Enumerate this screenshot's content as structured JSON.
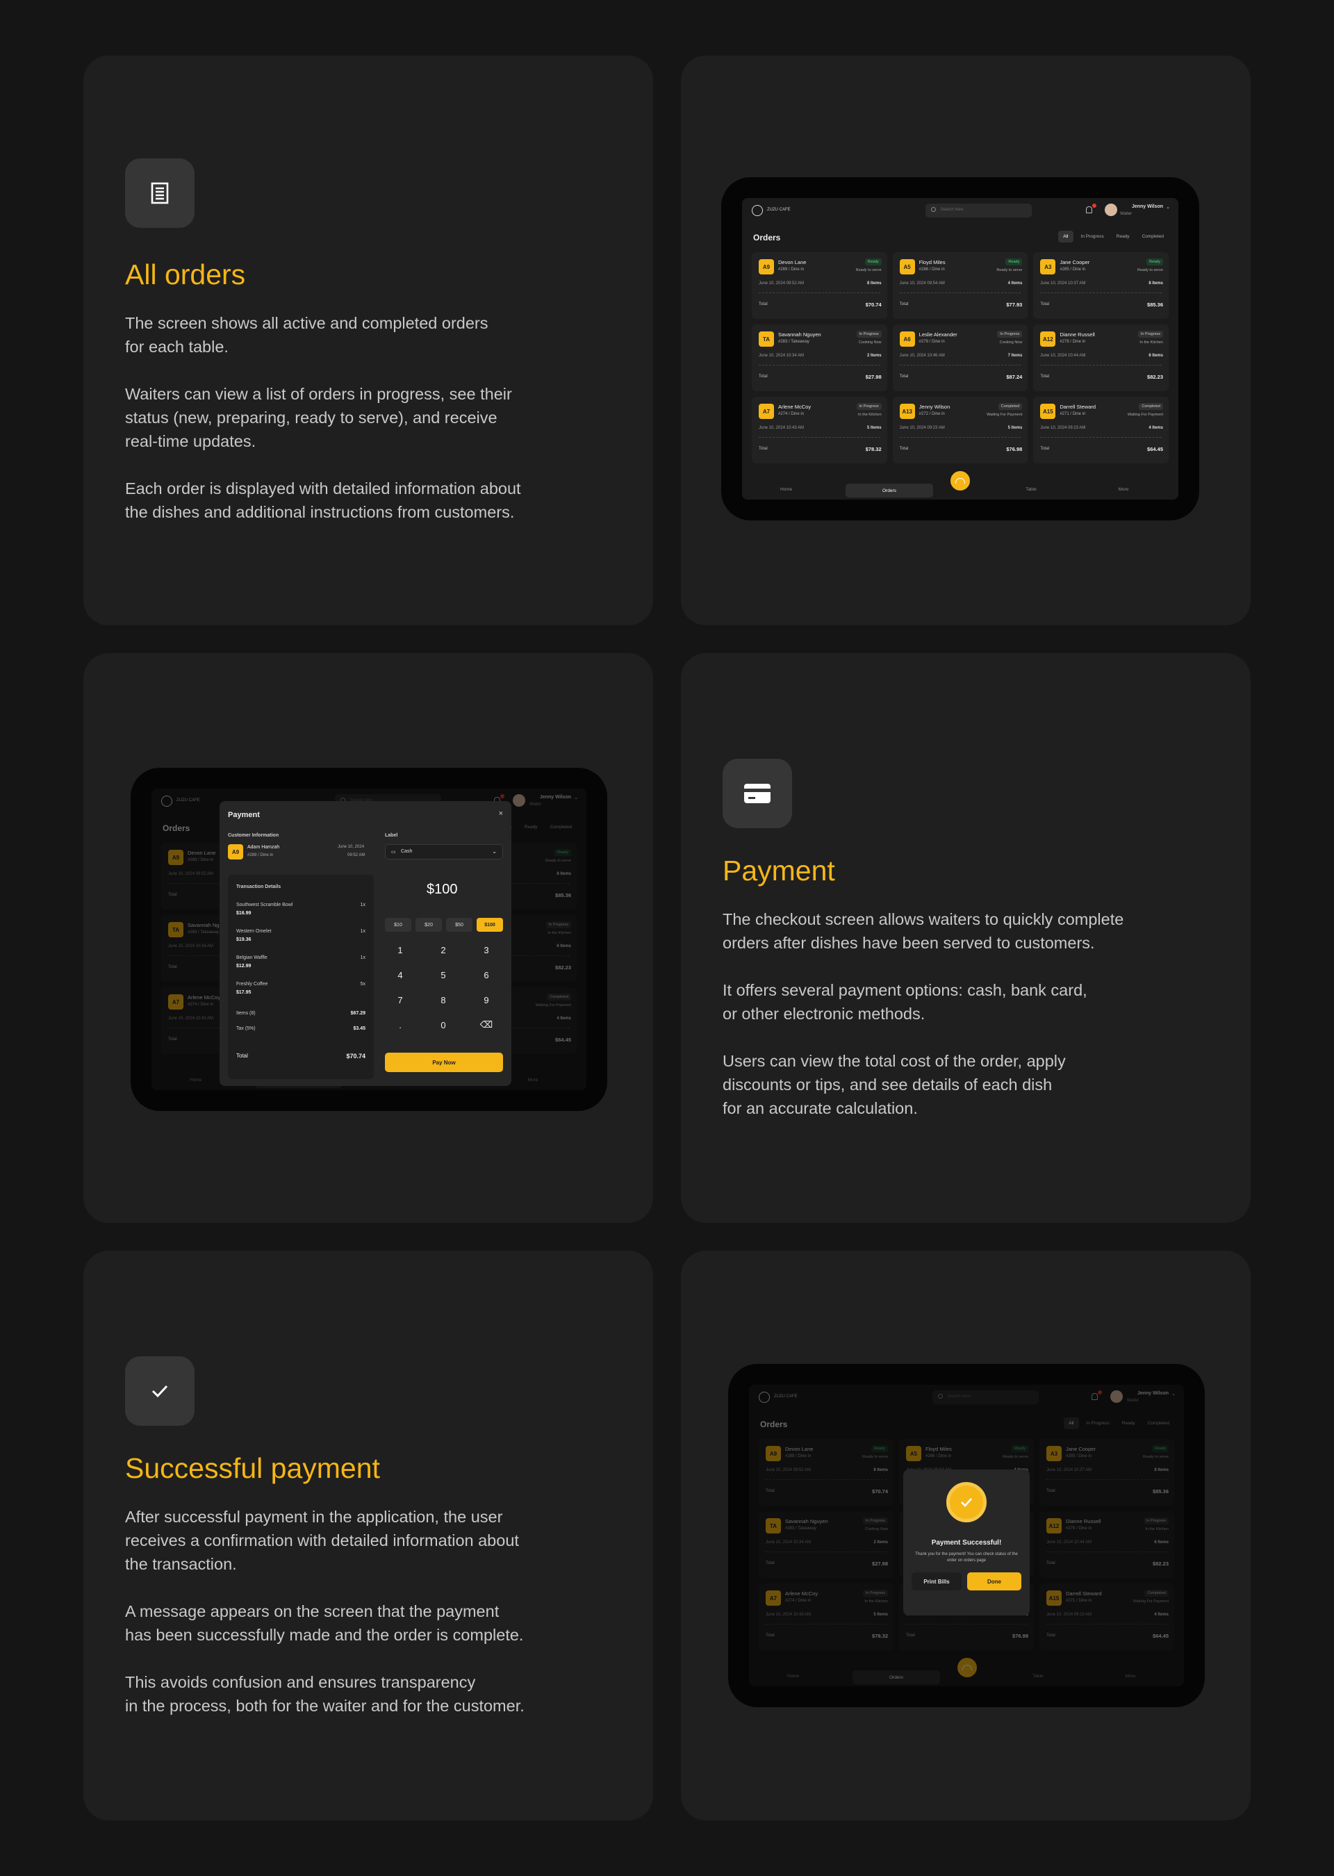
{
  "sections": {
    "all_orders": {
      "icon": "receipt-icon",
      "title": "All orders",
      "paragraphs": [
        "The screen shows all active and completed orders\nfor each table.",
        "Waiters can view a list of orders in progress, see their\nstatus (new, preparing, ready to serve), and receive\nreal-time updates.",
        "Each order is displayed with detailed information about\nthe dishes and additional instructions from customers."
      ]
    },
    "payment": {
      "icon": "credit-card-icon",
      "title": "Payment",
      "paragraphs": [
        "The checkout screen allows waiters to quickly complete\norders after dishes have been served to customers.",
        "It offers several payment options: cash, bank card,\nor other electronic methods.",
        "Users can view the total cost of the order, apply\ndiscounts or tips, and see details of each dish\nfor an accurate calculation."
      ]
    },
    "success": {
      "icon": "check-icon",
      "title": "Successful payment",
      "paragraphs": [
        "After successful payment in the application, the user\nreceives a confirmation with detailed information about\nthe transaction.",
        "A message appears on the screen that the payment\nhas been successfully made and the order is complete.",
        "This avoids confusion and ensures transparency\nin the process, both for the waiter and for the customer."
      ]
    }
  },
  "app": {
    "brand": "ZUZU CAFE",
    "search_placeholder": "Search here",
    "user_name": "Jenny Wilson",
    "user_role": "Waiter",
    "orders_title": "Orders",
    "filters": [
      "All",
      "In Progress",
      "Ready",
      "Completed"
    ],
    "total_label": "Total",
    "nav": {
      "home": "Home",
      "orders": "Orders",
      "table": "Table",
      "more": "More"
    },
    "orders": [
      {
        "tag": "A9",
        "name": "Devon Lane",
        "sub": "#289 / Dine in",
        "status": "Ready",
        "sdesc": "Ready to serve",
        "date": "June 10, 2024 09:52 AM",
        "items": "8 Items",
        "total": "$70.74",
        "ready": true
      },
      {
        "tag": "A5",
        "name": "Floyd Miles",
        "sub": "#286 / Dine in",
        "status": "Ready",
        "sdesc": "Ready to serve",
        "date": "June 10, 2024 09:54 AM",
        "items": "4 Items",
        "total": "$77.93",
        "ready": true
      },
      {
        "tag": "A3",
        "name": "Jane Cooper",
        "sub": "#285 / Dine in",
        "status": "Ready",
        "sdesc": "Ready to serve",
        "date": "June 10, 2024 10:37 AM",
        "items": "8 Items",
        "total": "$85.36",
        "ready": true
      },
      {
        "tag": "TA",
        "name": "Savannah Nguyen",
        "sub": "#283 / Takeaway",
        "status": "In Progress",
        "sdesc": "Cooking Now",
        "date": "June 10, 2024 10:34 AM",
        "items": "2 Items",
        "total": "$27.98",
        "ready": false
      },
      {
        "tag": "A6",
        "name": "Leslie Alexander",
        "sub": "#279 / Dine in",
        "status": "In Progress",
        "sdesc": "Cooking Now",
        "date": "June 10, 2024 10:46 AM",
        "items": "7 Items",
        "total": "$87.24",
        "ready": false
      },
      {
        "tag": "A12",
        "name": "Dianne Russell",
        "sub": "#278 / Dine in",
        "status": "In Progress",
        "sdesc": "In the Kitchen",
        "date": "June 10, 2024 10:44 AM",
        "items": "6 Items",
        "total": "$82.23",
        "ready": false
      },
      {
        "tag": "A7",
        "name": "Arlene McCoy",
        "sub": "#274 / Dine in",
        "status": "In Progress",
        "sdesc": "In the Kitchen",
        "date": "June 10, 2024 10:43 AM",
        "items": "5 Items",
        "total": "$78.32",
        "ready": false
      },
      {
        "tag": "A13",
        "name": "Jenny Wilson",
        "sub": "#272 / Dine in",
        "status": "Completed",
        "sdesc": "Waiting For Payment",
        "date": "June 10, 2024 09:23 AM",
        "items": "5 Items",
        "total": "$76.98",
        "ready": false
      },
      {
        "tag": "A15",
        "name": "Darrell Steward",
        "sub": "#271 / Dine in",
        "status": "Completed",
        "sdesc": "Waiting For Payment",
        "date": "June 10, 2024 09:23 AM",
        "items": "4 Items",
        "total": "$64.45",
        "ready": false
      }
    ]
  },
  "payment_modal": {
    "title": "Payment",
    "customer_info_label": "Customer Information",
    "customer_tag": "A9",
    "customer_name": "Adam Hamzah",
    "customer_sub": "#289 / Dine in",
    "date": "June 10, 2024",
    "time": "09:52 AM",
    "transaction_label": "Transaction Details",
    "items": [
      {
        "name": "Southwest Scramble Bowl",
        "qty": "1x",
        "price": "$16.99"
      },
      {
        "name": "Western Omelet",
        "qty": "1x",
        "price": "$19.36"
      },
      {
        "name": "Belgian Waffle",
        "qty": "1x",
        "price": "$12.99"
      },
      {
        "name": "Freshly Coffee",
        "qty": "5x",
        "price": "$17.95"
      }
    ],
    "items_label": "Items (8)",
    "items_total": "$67.29",
    "tax_label": "Tax (5%)",
    "tax": "$3.45",
    "total_label": "Total",
    "total": "$70.74",
    "method_label": "Label",
    "method": "Cash",
    "amount": "$100",
    "quick": [
      "$10",
      "$20",
      "$50",
      "$100"
    ],
    "keys": [
      "1",
      "2",
      "3",
      "4",
      "5",
      "6",
      "7",
      "8",
      "9",
      ".",
      "0",
      "⌫"
    ],
    "pay_button": "Pay Now"
  },
  "success_modal": {
    "title": "Payment Successful!",
    "message": "Thank you for the payment! You can check status of the order on orders page",
    "print": "Print Bills",
    "done": "Done"
  },
  "colors": {
    "accent": "#f5b617",
    "card": "#1f1f1f",
    "bg": "#151515"
  }
}
